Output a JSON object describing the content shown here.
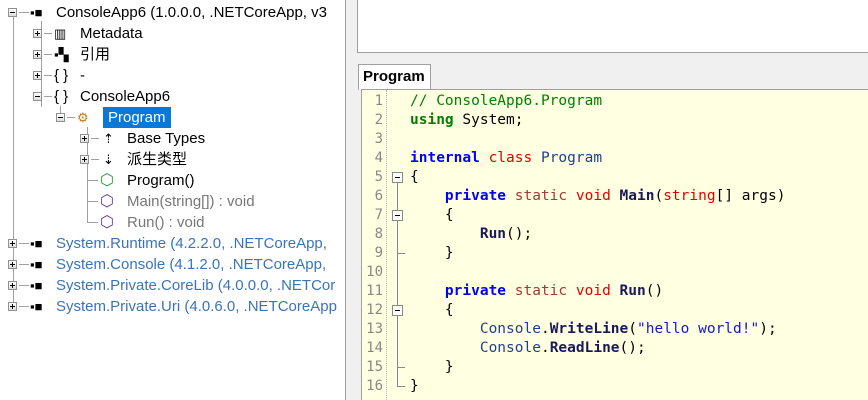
{
  "tree": {
    "root": "ConsoleApp6 (1.0.0.0, .NETCoreApp, v3",
    "metadata": "Metadata",
    "references": "引用",
    "ns_empty": "-",
    "ns_name": "ConsoleApp6",
    "class_name": "Program",
    "base_types": "Base Types",
    "derived_types": "派生类型",
    "ctor": "Program()",
    "main": "Main(string[]) : void",
    "run": "Run() : void",
    "assemblies": [
      "System.Runtime (4.2.2.0, .NETCoreApp,",
      "System.Console (4.1.2.0, .NETCoreApp,",
      "System.Private.CoreLib (4.0.0.0, .NETCor",
      "System.Private.Uri (4.0.6.0, .NETCoreApp"
    ]
  },
  "editor": {
    "tab_label": "Program",
    "colors": {
      "comment": "#008000",
      "kw": "#0000ff",
      "kw2": "#e00000",
      "static": "#a33a3a",
      "type": "#1f3f8f",
      "str": "#1515d0",
      "fn": "#1a1a5a",
      "def": "#000000"
    },
    "lines": [
      [
        [
          "// ConsoleApp6.Program",
          "comment",
          0
        ]
      ],
      [
        [
          "using",
          "comment",
          1
        ],
        [
          " System;",
          "def",
          0
        ]
      ],
      [],
      [
        [
          "internal",
          "kw",
          1
        ],
        [
          " ",
          "def",
          0
        ],
        [
          "class",
          "kw2",
          0
        ],
        [
          " Program",
          "type",
          0
        ]
      ],
      [
        [
          "{",
          "def",
          0
        ]
      ],
      [
        [
          "    ",
          "def",
          0
        ],
        [
          "private",
          "kw",
          1
        ],
        [
          " ",
          "def",
          0
        ],
        [
          "static",
          "static",
          0
        ],
        [
          " ",
          "def",
          0
        ],
        [
          "void",
          "kw2",
          0
        ],
        [
          " ",
          "def",
          0
        ],
        [
          "Main",
          "fn",
          1
        ],
        [
          "(",
          "def",
          0
        ],
        [
          "string",
          "kw2",
          0
        ],
        [
          "[] args)",
          "def",
          0
        ]
      ],
      [
        [
          "    {",
          "def",
          0
        ]
      ],
      [
        [
          "        ",
          "def",
          0
        ],
        [
          "Run",
          "fn",
          1
        ],
        [
          "();",
          "def",
          0
        ]
      ],
      [
        [
          "    }",
          "def",
          0
        ]
      ],
      [],
      [
        [
          "    ",
          "def",
          0
        ],
        [
          "private",
          "kw",
          1
        ],
        [
          " ",
          "def",
          0
        ],
        [
          "static",
          "static",
          0
        ],
        [
          " ",
          "def",
          0
        ],
        [
          "void",
          "kw2",
          0
        ],
        [
          " ",
          "def",
          0
        ],
        [
          "Run",
          "fn",
          1
        ],
        [
          "()",
          "def",
          0
        ]
      ],
      [
        [
          "    {",
          "def",
          0
        ]
      ],
      [
        [
          "        ",
          "def",
          0
        ],
        [
          "Console",
          "type",
          0
        ],
        [
          ".",
          "def",
          0
        ],
        [
          "WriteLine",
          "fn",
          1
        ],
        [
          "(",
          "def",
          0
        ],
        [
          "\"hello world!\"",
          "str",
          0
        ],
        [
          ");",
          "def",
          0
        ]
      ],
      [
        [
          "        ",
          "def",
          0
        ],
        [
          "Console",
          "type",
          0
        ],
        [
          ".",
          "def",
          0
        ],
        [
          "ReadLine",
          "fn",
          1
        ],
        [
          "();",
          "def",
          0
        ]
      ],
      [
        [
          "    }",
          "def",
          0
        ]
      ],
      [
        [
          "}",
          "def",
          0
        ]
      ]
    ]
  }
}
